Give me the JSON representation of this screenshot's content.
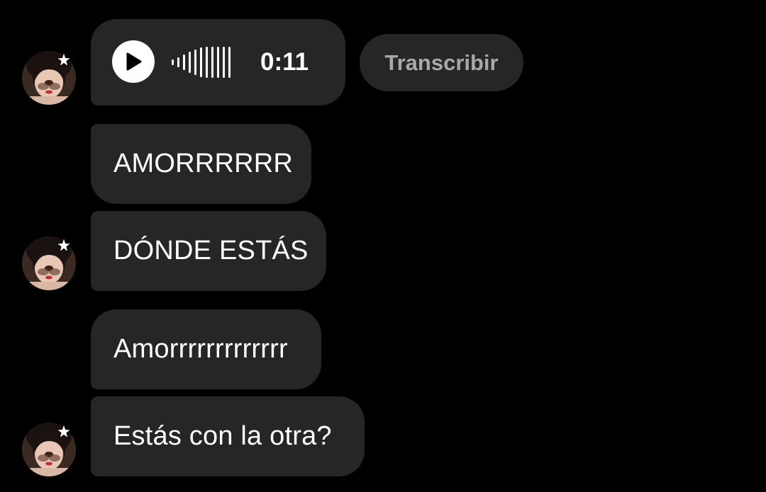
{
  "messages": {
    "voice": {
      "duration": "0:11",
      "transcribe_label": "Transcribir"
    },
    "text_1": "AMORRRRRR",
    "text_2": "DÓNDE ESTÁS",
    "text_3": "Amorrrrrrrrrrrrr",
    "text_4": "Estás con la otra?"
  },
  "colors": {
    "background": "#000000",
    "bubble": "#262626",
    "text": "#ffffff",
    "secondary_text": "#a8a8a8"
  },
  "icons": {
    "play": "play-icon",
    "waveform": "waveform-icon",
    "avatar": "avatar-image",
    "sparkle": "sparkle-star-icon"
  }
}
